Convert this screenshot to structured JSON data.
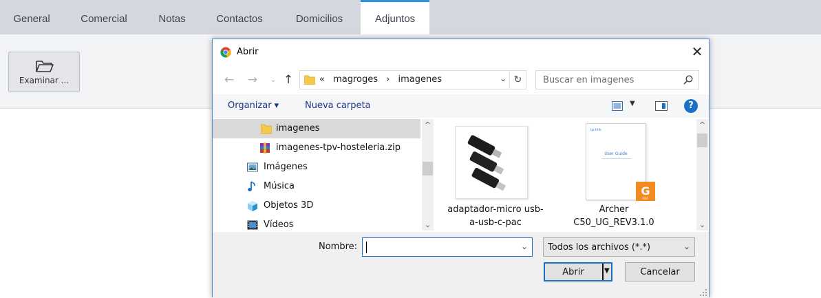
{
  "tabs": [
    {
      "label": "General"
    },
    {
      "label": "Comercial"
    },
    {
      "label": "Notas"
    },
    {
      "label": "Contactos"
    },
    {
      "label": "Domicilios"
    },
    {
      "label": "Adjuntos",
      "active": true
    }
  ],
  "browse_button": {
    "label": "Examinar ..."
  },
  "dialog": {
    "title": "Abrir",
    "nav": {
      "breadcrumb_prefix": "«",
      "path": [
        "magroges",
        "imagenes"
      ],
      "search_placeholder": "Buscar en imagenes"
    },
    "toolbar": {
      "organize": "Organizar ▾",
      "new_folder": "Nueva carpeta"
    },
    "tree": [
      {
        "label": "imagenes",
        "icon": "folder-icon",
        "selected": true
      },
      {
        "label": "imagenes-tpv-hosteleria.zip",
        "icon": "winrar-archive-icon"
      },
      {
        "label": "Imágenes",
        "icon": "pictures-icon"
      },
      {
        "label": "Música",
        "icon": "music-icon"
      },
      {
        "label": "Objetos 3D",
        "icon": "objects-3d-icon"
      },
      {
        "label": "Vídeos",
        "icon": "videos-icon"
      }
    ],
    "files": [
      {
        "name": "adaptador-micro usb-a-usb-c-pac"
      },
      {
        "name": "Archer C50_UG_REV3.1.0",
        "thumb_text": "User Guide"
      }
    ],
    "filename_label": "Nombre:",
    "filename_value": "",
    "filetype": "Todos los archivos (*.*)",
    "open_label": "Abrir",
    "cancel_label": "Cancelar"
  },
  "colors": {
    "accent": "#2d8fd5",
    "dialog_border": "#4a90d9",
    "link": "#1e3287"
  }
}
